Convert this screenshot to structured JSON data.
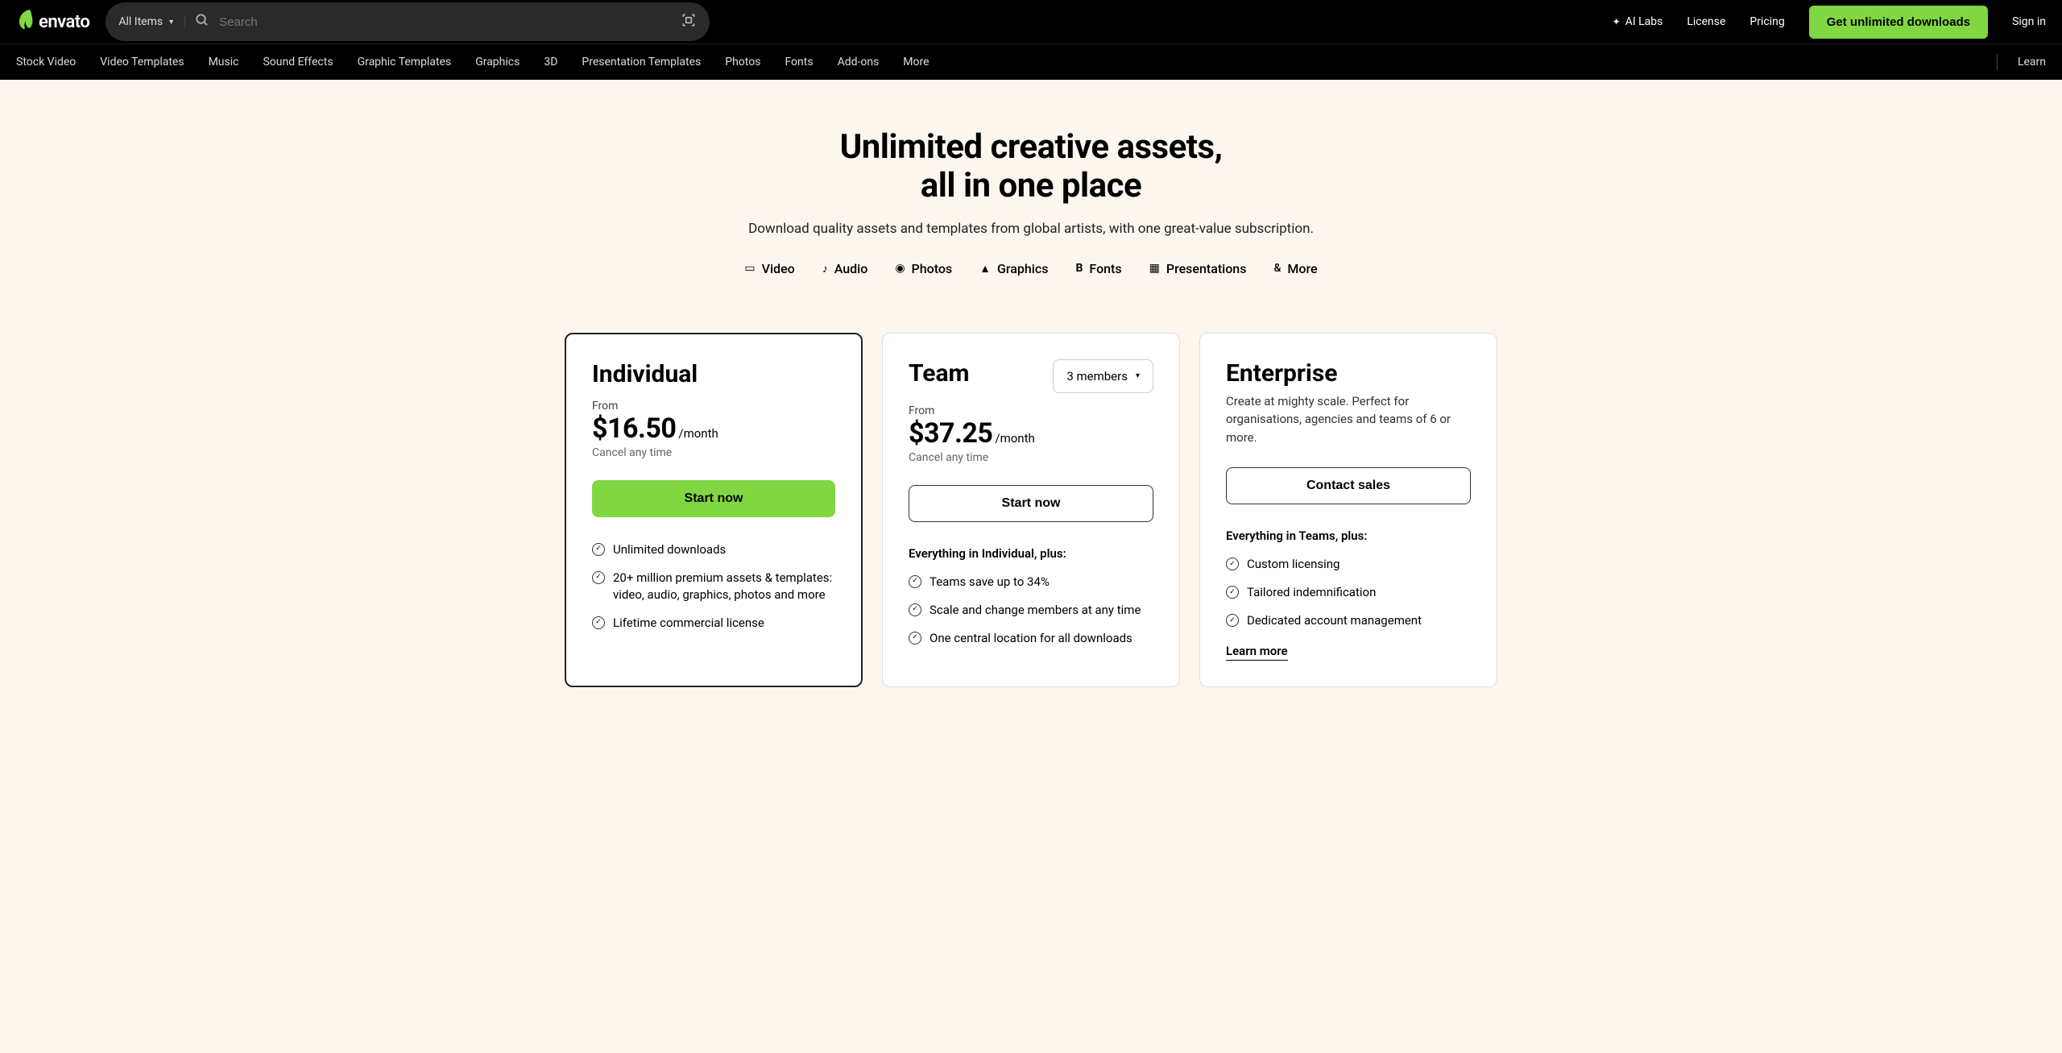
{
  "header": {
    "logo_text": "envato",
    "search_category": "All Items",
    "search_placeholder": "Search",
    "links": {
      "ai_labs": "AI Labs",
      "license": "License",
      "pricing": "Pricing"
    },
    "cta": "Get unlimited downloads",
    "signin": "Sign in"
  },
  "nav": {
    "items": [
      "Stock Video",
      "Video Templates",
      "Music",
      "Sound Effects",
      "Graphic Templates",
      "Graphics",
      "3D",
      "Presentation Templates",
      "Photos",
      "Fonts",
      "Add-ons",
      "More"
    ],
    "learn": "Learn"
  },
  "hero": {
    "title_line1": "Unlimited creative assets,",
    "title_line2": "all in one place",
    "subtitle": "Download quality assets and templates from global artists, with one great-value subscription.",
    "asset_types": [
      "Video",
      "Audio",
      "Photos",
      "Graphics",
      "Fonts",
      "Presentations",
      "More"
    ]
  },
  "pricing": {
    "individual": {
      "name": "Individual",
      "from_label": "From",
      "price": "$16.50",
      "suffix": "/month",
      "cancel": "Cancel any time",
      "button": "Start now",
      "features": [
        "Unlimited downloads",
        "20+ million premium assets & templates: video, audio, graphics, photos and more",
        "Lifetime commercial license"
      ]
    },
    "team": {
      "name": "Team",
      "members_select": "3 members",
      "from_label": "From",
      "price": "$37.25",
      "suffix": "/month",
      "cancel": "Cancel any time",
      "button": "Start now",
      "features_header": "Everything in Individual, plus:",
      "features": [
        "Teams save up to 34%",
        "Scale and change members at any time",
        "One central location for all downloads"
      ]
    },
    "enterprise": {
      "name": "Enterprise",
      "description": "Create at mighty scale. Perfect for organisations, agencies and teams of 6 or more.",
      "button": "Contact sales",
      "features_header": "Everything in Teams, plus:",
      "features": [
        "Custom licensing",
        "Tailored indemnification",
        "Dedicated account management"
      ],
      "learn_more": "Learn more"
    }
  }
}
